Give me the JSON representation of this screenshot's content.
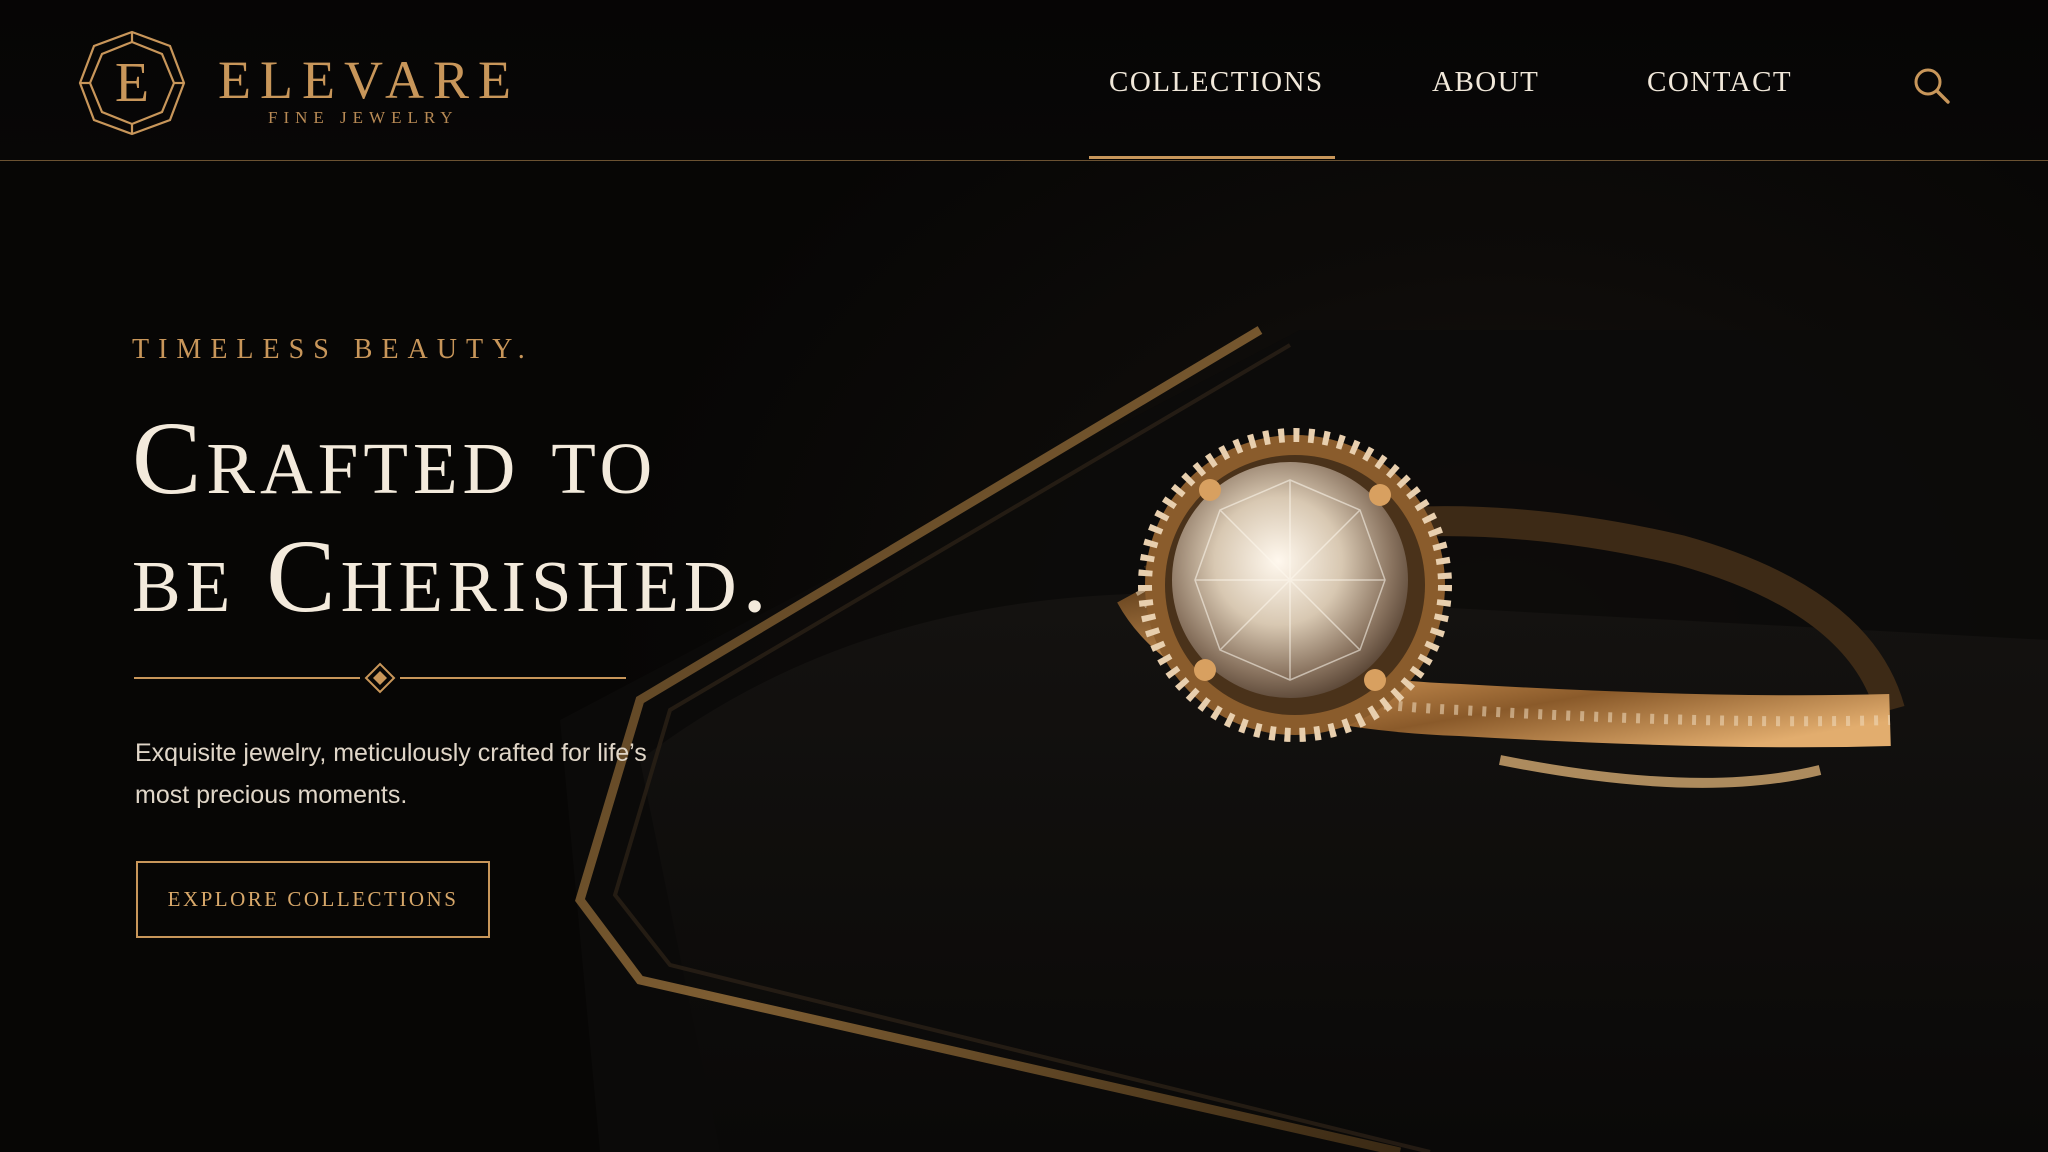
{
  "brand": {
    "logo_letter": "E",
    "name": "ELEVARE",
    "tagline": "FINE JEWELRY"
  },
  "nav": {
    "items": [
      {
        "label": "COLLECTIONS",
        "active": true
      },
      {
        "label": "ABOUT",
        "active": false
      },
      {
        "label": "CONTACT",
        "active": false
      }
    ],
    "search_icon": "search-icon"
  },
  "hero": {
    "eyebrow": "TIMELESS BEAUTY.",
    "headline_line1": "Crafted to",
    "headline_line2": "be Cherished.",
    "description": "Exquisite jewelry, meticulously crafted for life’s most precious moments.",
    "cta_label": "EXPLORE COLLECTIONS",
    "image": "diamond-halo-ring-in-velvet-box"
  },
  "colors": {
    "accent_gold": "#c8965a",
    "background": "#080706",
    "text_light": "#f3eadc"
  }
}
